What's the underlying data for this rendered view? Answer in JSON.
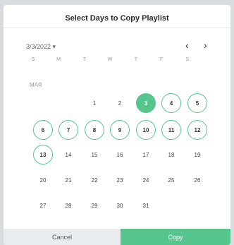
{
  "dialog": {
    "title": "Select Days to Copy Playlist"
  },
  "calendar": {
    "date_picker_value": "3/3/2022 ▾",
    "prev_label": "‹",
    "next_label": "›",
    "weekdays": [
      "S",
      "M",
      "T",
      "W",
      "T",
      "F",
      "S"
    ],
    "month_label": "MAR",
    "today": "3",
    "selected_days": [
      "4",
      "5",
      "6",
      "7",
      "8",
      "9",
      "10",
      "11",
      "12",
      "13"
    ],
    "weeks": [
      [
        "",
        "",
        "1",
        "2",
        "3",
        "4",
        "5"
      ],
      [
        "6",
        "7",
        "8",
        "9",
        "10",
        "11",
        "12"
      ],
      [
        "13",
        "14",
        "15",
        "16",
        "17",
        "18",
        "19"
      ],
      [
        "20",
        "21",
        "22",
        "23",
        "24",
        "25",
        "26"
      ],
      [
        "27",
        "28",
        "29",
        "30",
        "31",
        "",
        ""
      ]
    ]
  },
  "footer": {
    "cancel_label": "Cancel",
    "copy_label": "Copy"
  },
  "colors": {
    "accent": "#56c68e",
    "cancel_bg": "#e9ecee"
  }
}
